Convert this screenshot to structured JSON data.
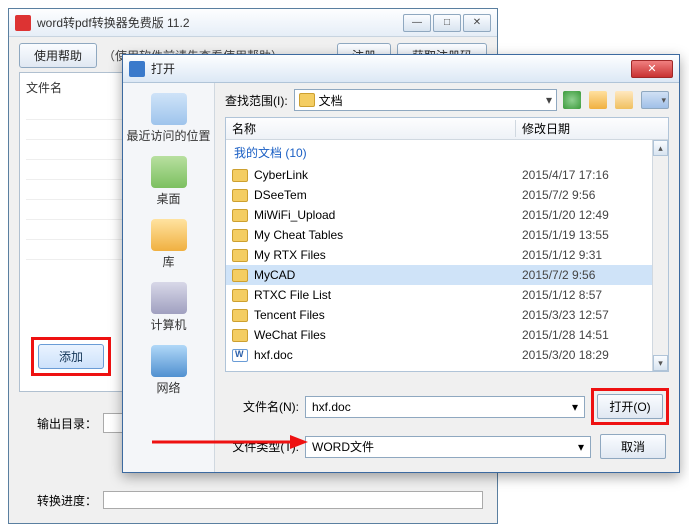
{
  "main": {
    "title": "word转pdf转换器免费版 11.2",
    "help_btn": "使用帮助",
    "hint": "（使用软件前请先查看使用帮助）",
    "register_btn": "注册",
    "getcode_btn": "获取注册码",
    "col_name": "文件名",
    "add_btn": "添加",
    "outdir_label": "输出目录：",
    "progress_label": "转换进度："
  },
  "dlg": {
    "title": "打开",
    "lookin_label": "查找范围(I):",
    "lookin_value": "文档",
    "places": {
      "recent": "最近访问的位置",
      "desktop": "桌面",
      "library": "库",
      "computer": "计算机",
      "network": "网络"
    },
    "head_name": "名称",
    "head_date": "修改日期",
    "mydocs": "我的文档 (10)",
    "files": [
      {
        "name": "CyberLink",
        "date": "2015/4/17 17:16",
        "type": "folder"
      },
      {
        "name": "DSeeTem",
        "date": "2015/7/2 9:56",
        "type": "folder"
      },
      {
        "name": "MiWiFi_Upload",
        "date": "2015/1/20 12:49",
        "type": "folder"
      },
      {
        "name": "My Cheat Tables",
        "date": "2015/1/19 13:55",
        "type": "folder"
      },
      {
        "name": "My RTX Files",
        "date": "2015/1/12 9:31",
        "type": "folder"
      },
      {
        "name": "MyCAD",
        "date": "2015/7/2 9:56",
        "type": "folder",
        "selected": true
      },
      {
        "name": "RTXC File List",
        "date": "2015/1/12 8:57",
        "type": "folder"
      },
      {
        "name": "Tencent Files",
        "date": "2015/3/23 12:57",
        "type": "folder"
      },
      {
        "name": "WeChat Files",
        "date": "2015/1/28 14:51",
        "type": "folder"
      },
      {
        "name": "hxf.doc",
        "date": "2015/3/20 18:29",
        "type": "doc"
      }
    ],
    "filename_label": "文件名(N):",
    "filename_value": "hxf.doc",
    "filetype_label": "文件类型(T):",
    "filetype_value": "WORD文件",
    "open_btn": "打开(O)",
    "cancel_btn": "取消"
  }
}
